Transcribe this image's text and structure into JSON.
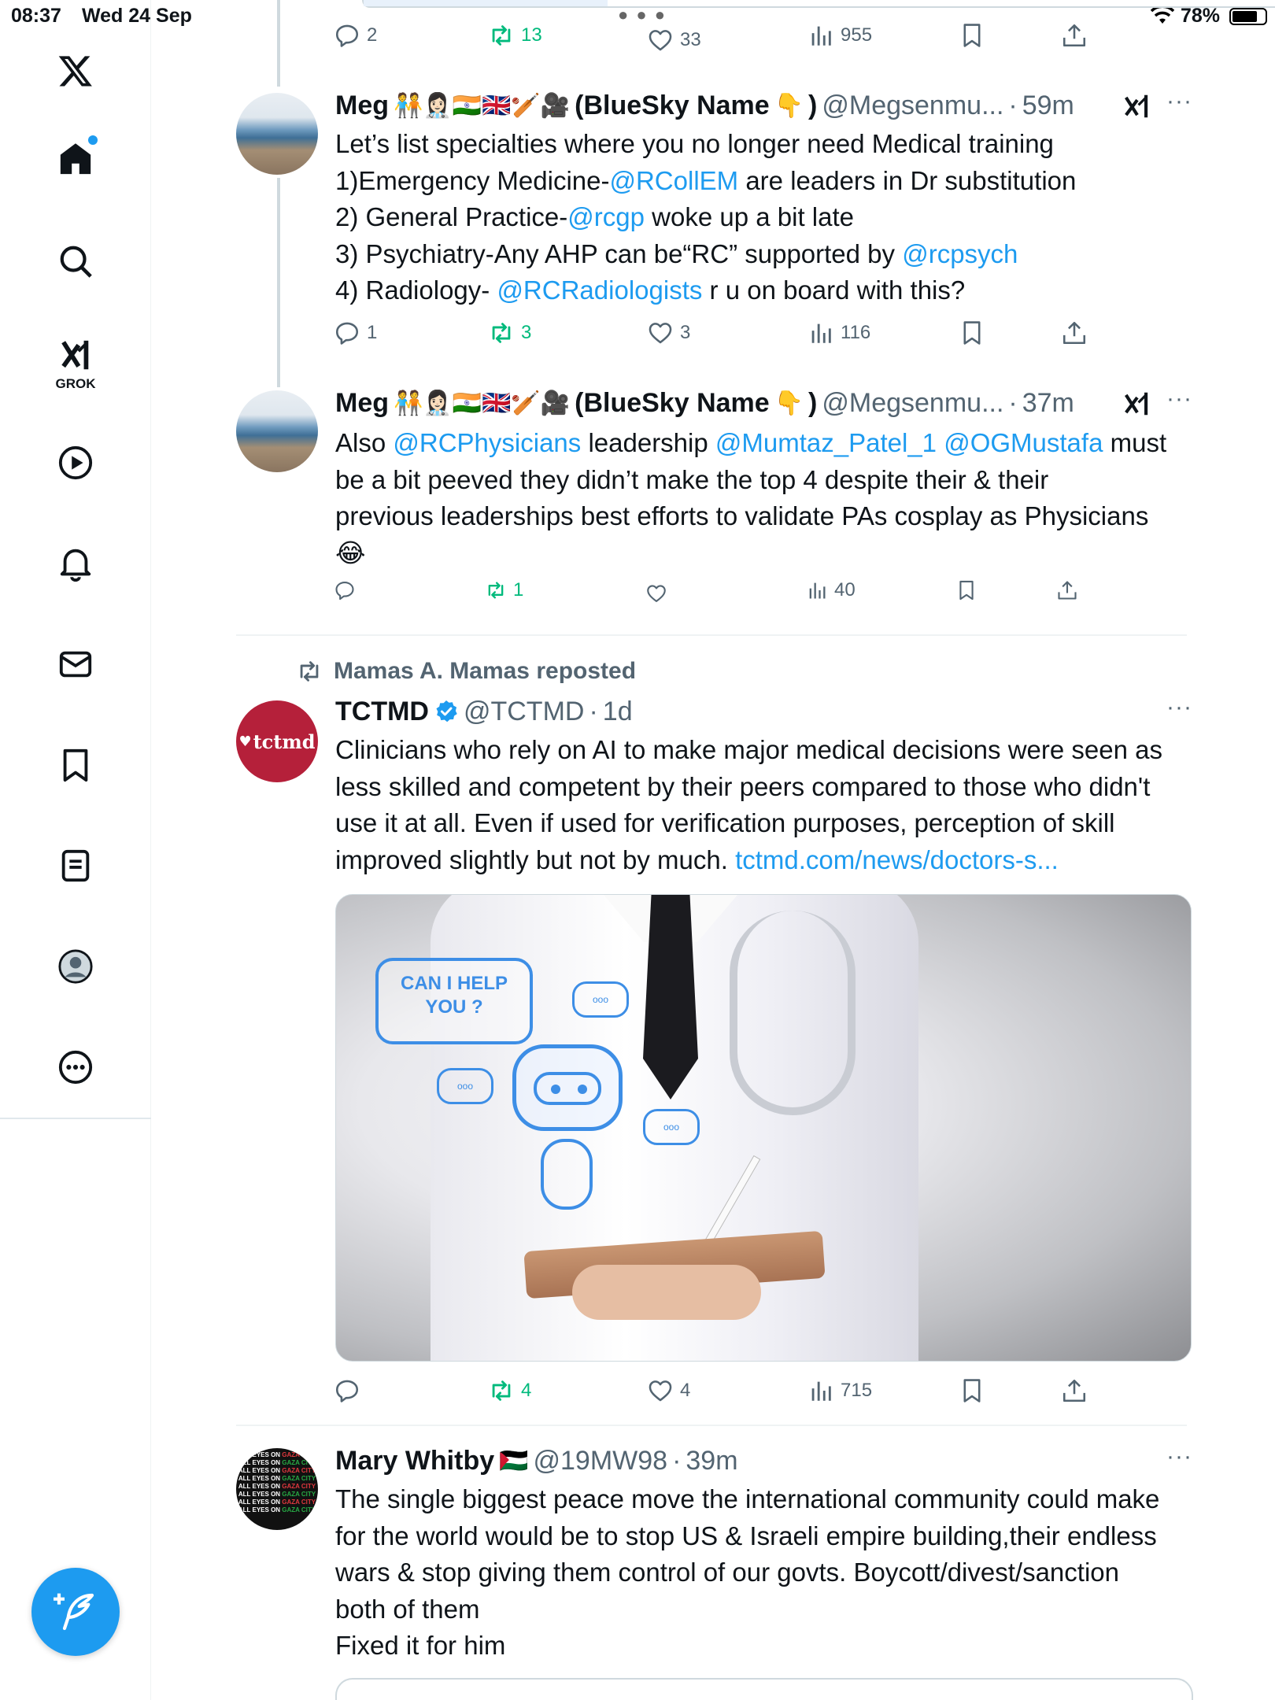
{
  "status_bar": {
    "time": "08:37",
    "date": "Wed 24 Sep",
    "battery": "78%",
    "battery_level": 0.78
  },
  "sidebar": {
    "items": [
      {
        "name": "x-logo-icon"
      },
      {
        "name": "home-icon",
        "has_notification_dot": true
      },
      {
        "name": "search-icon"
      },
      {
        "name": "grok-icon",
        "label": "GROK"
      },
      {
        "name": "video-icon"
      },
      {
        "name": "notifications-icon"
      },
      {
        "name": "messages-icon"
      },
      {
        "name": "bookmarks-icon"
      },
      {
        "name": "lists-icon"
      },
      {
        "name": "profile-icon"
      },
      {
        "name": "more-icon"
      }
    ],
    "compose_icon": "feather-plus-icon"
  },
  "top_actions": {
    "replies": "2",
    "reposts": "13",
    "likes": "33",
    "views": "955"
  },
  "tweets": [
    {
      "name": "Meg",
      "emojis": "🧑‍🤝‍🧑👩🏻‍⚕️🇮🇳🇬🇧🏏🎥",
      "name_suffix": "(BlueSky Name",
      "name_suffix_emoji": "👇",
      "name_close": ")",
      "handle": "@Megsenmu...",
      "dot": "·",
      "time": "59m",
      "lines": [
        {
          "parts": [
            {
              "text": "Let’s list specialties where you no longer need Medical training",
              "link": false
            }
          ]
        },
        {
          "parts": [
            {
              "text": "1)Emergency Medicine-",
              "link": false
            },
            {
              "text": "@RCollEM",
              "link": true
            },
            {
              "text": " are leaders in Dr substitution",
              "link": false
            }
          ]
        },
        {
          "parts": [
            {
              "text": "2) General Practice-",
              "link": false
            },
            {
              "text": "@rcgp",
              "link": true
            },
            {
              "text": " woke up a bit late",
              "link": false
            }
          ]
        },
        {
          "parts": [
            {
              "text": "3) Psychiatry-Any AHP can be“RC” supported by ",
              "link": false
            },
            {
              "text": "@rcpsych",
              "link": true
            }
          ]
        },
        {
          "parts": [
            {
              "text": "4) Radiology- ",
              "link": false
            },
            {
              "text": "@RCRadiologists",
              "link": true
            },
            {
              "text": " r u on board with this?",
              "link": false
            }
          ]
        }
      ],
      "actions": {
        "replies": "1",
        "reposts": "3",
        "likes": "3",
        "views": "116"
      }
    },
    {
      "name": "Meg",
      "emojis": "🧑‍🤝‍🧑👩🏻‍⚕️🇮🇳🇬🇧🏏🎥",
      "name_suffix": "(BlueSky Name",
      "name_suffix_emoji": "👇",
      "name_close": ")",
      "handle": "@Megsenmu...",
      "dot": "·",
      "time": "37m",
      "lines": [
        {
          "parts": [
            {
              "text": "Also ",
              "link": false
            },
            {
              "text": "@RCPhysicians",
              "link": true
            },
            {
              "text": " leadership ",
              "link": false
            },
            {
              "text": "@Mumtaz_Patel_1",
              "link": true
            },
            {
              "text": " ",
              "link": false
            },
            {
              "text": "@OGMustafa",
              "link": true
            },
            {
              "text": " must",
              "link": false
            }
          ]
        },
        {
          "parts": [
            {
              "text": "be a bit peeved they didn’t make the top 4 despite their & their",
              "link": false
            }
          ]
        },
        {
          "parts": [
            {
              "text": "previous leaderships best efforts to validate PAs cosplay as Physicians",
              "link": false
            }
          ]
        },
        {
          "parts": [
            {
              "text": "😂",
              "link": false
            }
          ]
        }
      ],
      "actions": {
        "replies": "",
        "reposts": "1",
        "likes": "",
        "views": "40"
      }
    },
    {
      "repost_label": "Mamas A. Mamas reposted",
      "name": "TCTMD",
      "avatar_text": "tctmd",
      "avatar_heart": "♥",
      "handle": "@TCTMD",
      "dot": "·",
      "time": "1d",
      "lines": [
        {
          "parts": [
            {
              "text": "Clinicians who rely on AI to make major medical decisions were seen as",
              "link": false
            }
          ]
        },
        {
          "parts": [
            {
              "text": "less skilled and competent by their peers compared to those who didn't",
              "link": false
            }
          ]
        },
        {
          "parts": [
            {
              "text": "use it at all. Even if used for verification purposes, perception of skill",
              "link": false
            }
          ]
        },
        {
          "parts": [
            {
              "text": "improved slightly but not by much. ",
              "link": false
            },
            {
              "text": "tctmd.com/news/doctors-s...",
              "link": true
            }
          ]
        }
      ],
      "media_text": "CAN I HELP YOU ?",
      "media_bubble_text": "ooo",
      "actions": {
        "replies": "",
        "reposts": "4",
        "likes": "4",
        "views": "715"
      }
    },
    {
      "name": "Mary Whitby",
      "emojis": "🇵🇸",
      "handle": "@19MW98",
      "dot": "·",
      "time": "39m",
      "avatar_lines": [
        "ALL EYES ON GAZA CITY",
        "ALL EYES ON GAZA CITY",
        "ALL EYES ON GAZA CITY",
        "ALL EYES ON GAZA CITY",
        "ALL EYES ON GAZA CITY",
        "ALL EYES ON GAZA CITY",
        "ALL EYES ON GAZA CITY",
        "ALL EYES ON GAZA CITY"
      ],
      "lines": [
        {
          "parts": [
            {
              "text": "The single biggest peace move the international community could make",
              "link": false
            }
          ]
        },
        {
          "parts": [
            {
              "text": "for the world would be to stop US & Israeli empire building,their endless",
              "link": false
            }
          ]
        },
        {
          "parts": [
            {
              "text": "wars & stop giving them control of our govts. Boycott/divest/sanction",
              "link": false
            }
          ]
        },
        {
          "parts": [
            {
              "text": "both of them",
              "link": false
            }
          ]
        },
        {
          "parts": [
            {
              "text": "Fixed it for him",
              "link": false
            }
          ]
        }
      ]
    }
  ]
}
